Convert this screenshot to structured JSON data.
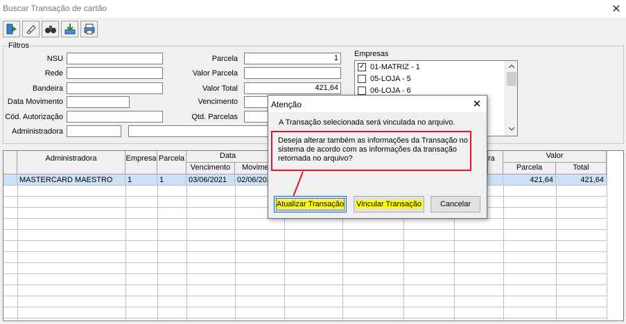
{
  "window": {
    "title": "Buscar Transação de cartão",
    "close_glyph": "✕"
  },
  "toolbar": {
    "buttons": [
      "exit-icon",
      "eraser-icon",
      "binoculars-icon",
      "import-icon",
      "printer-icon"
    ]
  },
  "filters": {
    "legend": "Filtros",
    "nsu_label": "NSU",
    "nsu_value": "",
    "rede_label": "Rede",
    "rede_value": "",
    "bandeira_label": "Bandeira",
    "bandeira_value": "",
    "data_movimento_label": "Data Movimento",
    "data_movimento_value": "",
    "cod_autorizacao_label": "Cód. Autorização",
    "cod_autorizacao_value": "",
    "administradora_label": "Administradora",
    "administradora_code": "",
    "administradora_name": "",
    "parcela_label": "Parcela",
    "parcela_value": "1",
    "valor_parcela_label": "Valor Parcela",
    "valor_parcela_value": "",
    "valor_total_label": "Valor Total",
    "valor_total_value": "421,64",
    "vencimento_label": "Vencimento",
    "vencimento_value": "",
    "qtd_parcelas_label": "Qtd. Parcelas",
    "qtd_parcelas_value": ""
  },
  "empresas": {
    "label": "Empresas",
    "items": [
      {
        "label": "01-MATRIZ - 1",
        "checked": true,
        "mark": "✓"
      },
      {
        "label": "05-LOJA - 5",
        "checked": false,
        "mark": ""
      },
      {
        "label": "06-LOJA - 6",
        "checked": false,
        "mark": ""
      }
    ]
  },
  "grid": {
    "headers": {
      "administradora": "Administradora",
      "empresa": "Empresa",
      "parcela": "Parcela",
      "data_group": "Data",
      "vencimento": "Vencimento",
      "movimento": "Movimento",
      "ra_partial": "ra",
      "valor_group": "Valor",
      "valor_parcela": "Parcela",
      "valor_total": "Total"
    },
    "rows": [
      {
        "administradora": "MASTERCARD MAESTRO",
        "empresa": "1",
        "parcela": "1",
        "vencimento": "03/06/2021",
        "movimento": "02/06/2021",
        "valor_parcela": "421,64",
        "valor_total": "421,64"
      }
    ]
  },
  "dialog": {
    "title": "Atenção",
    "close_glyph": "✕",
    "message": "A Transação selecionada será vinculada no arquivo.",
    "question": "Deseja alterar também as informações da Transação no sistema de acordo com as informações da transação retornada no arquivo?",
    "buttons": {
      "atualizar": "Atualizar Transação",
      "vincular": "Vincular Transação",
      "cancelar": "Cancelar"
    },
    "highlight_color": "#e8112d"
  }
}
